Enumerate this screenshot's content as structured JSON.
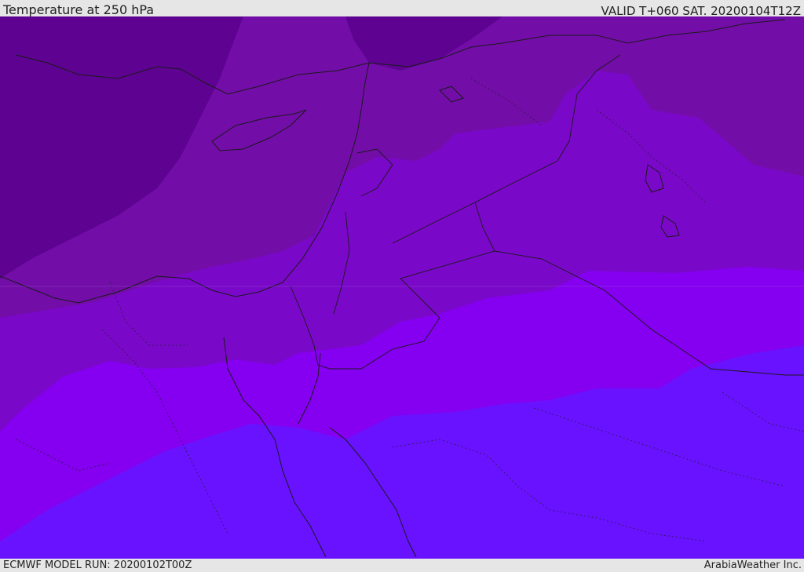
{
  "header": {
    "title": "Temperature at 250 hPa",
    "valid": "VALID T+060 SAT. 20200104T12Z"
  },
  "footer": {
    "model_run": "ECMWF MODEL RUN: 20200102T00Z",
    "credit": "ArabiaWeather Inc."
  },
  "map": {
    "region": "Eastern Mediterranean and Middle East",
    "field_colors": [
      "#5e0391",
      "#730da8",
      "#7a08c8",
      "#8500f0",
      "#6912ff"
    ],
    "border_color": "#1a1a1a"
  }
}
